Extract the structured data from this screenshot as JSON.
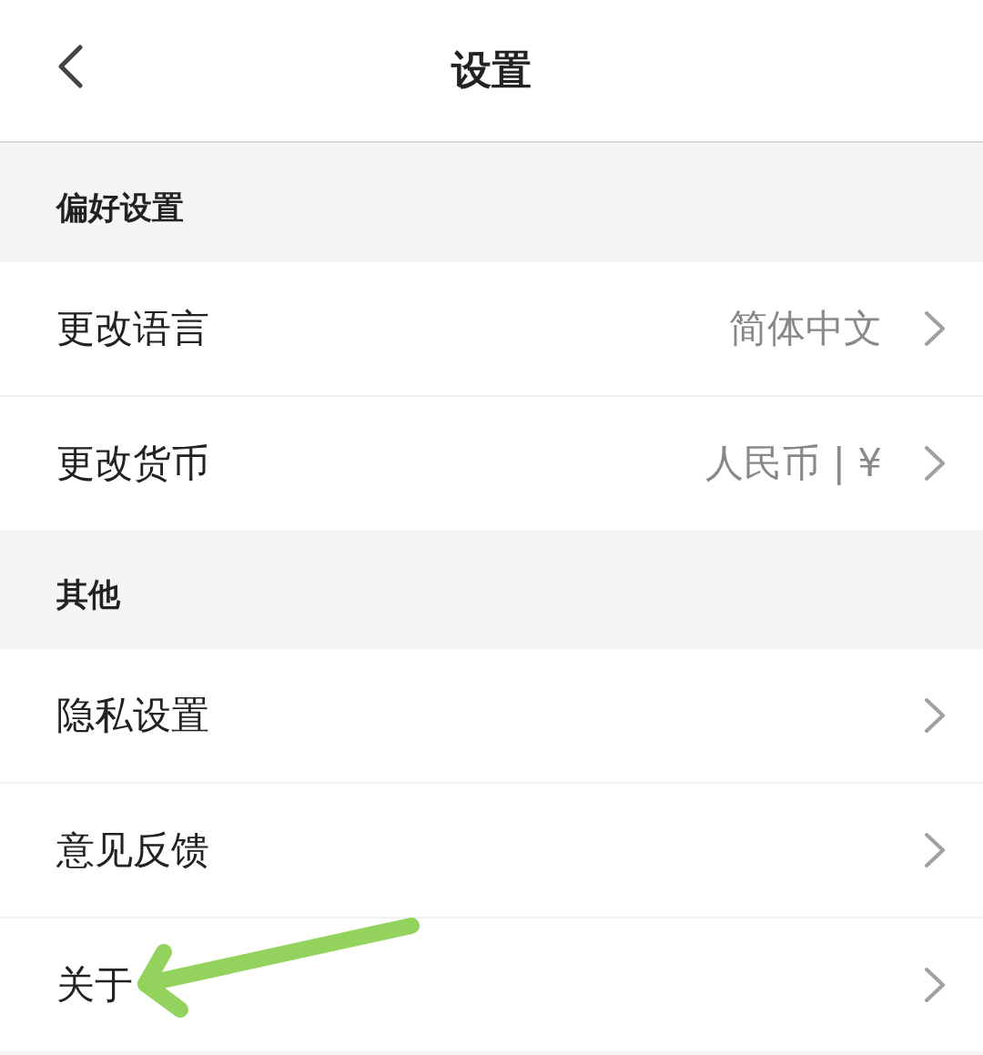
{
  "header": {
    "title": "设置"
  },
  "sections": [
    {
      "title": "偏好设置",
      "rows": [
        {
          "label": "更改语言",
          "value": "简体中文",
          "marked": false
        },
        {
          "label": "更改货币",
          "value": "人民币 | ¥",
          "marked": false
        }
      ]
    },
    {
      "title": "其他",
      "rows": [
        {
          "label": "隐私设置",
          "marked": false
        },
        {
          "label": "意见反馈",
          "marked": false
        },
        {
          "label": "关于",
          "marked": true
        }
      ]
    }
  ]
}
